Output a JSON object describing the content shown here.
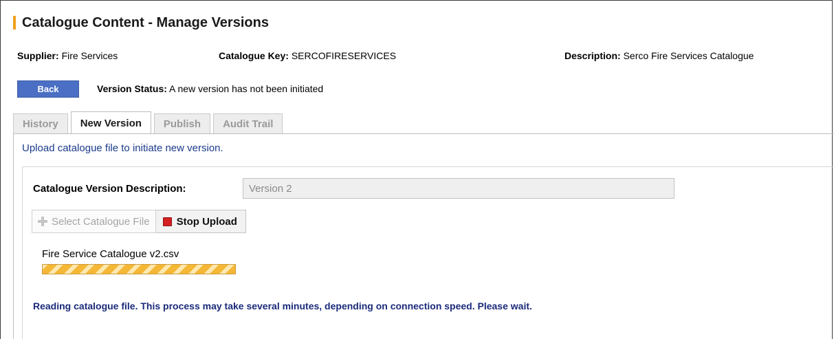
{
  "page_title": "Catalogue Content - Manage Versions",
  "meta": {
    "supplier_label": "Supplier:",
    "supplier_value": "Fire Services",
    "key_label": "Catalogue Key:",
    "key_value": "SERCOFIRESERVICES",
    "description_label": "Description:",
    "description_value": "Serco Fire Services Catalogue"
  },
  "back_button": "Back",
  "version_status": {
    "label": "Version Status:",
    "value": "A new version has not been initiated"
  },
  "tabs": [
    {
      "label": "History",
      "active": false
    },
    {
      "label": "New Version",
      "active": true
    },
    {
      "label": "Publish",
      "active": false
    },
    {
      "label": "Audit Trail",
      "active": false
    }
  ],
  "upload_hint": "Upload catalogue file to initiate new version.",
  "form": {
    "description_label": "Catalogue Version Description:",
    "description_value": "Version 2",
    "select_button": "Select Catalogue File",
    "stop_button": "Stop Upload"
  },
  "upload": {
    "file_name": "Fire Service Catalogue v2.csv",
    "progress_percent": 100
  },
  "reading_message": "Reading catalogue file. This process may take several minutes, depending on connection speed. Please wait.",
  "colors": {
    "accent": "#f0a020",
    "back_button": "#4a6fc4",
    "link_text": "#1a3a8a",
    "progress": "#f4b736"
  }
}
